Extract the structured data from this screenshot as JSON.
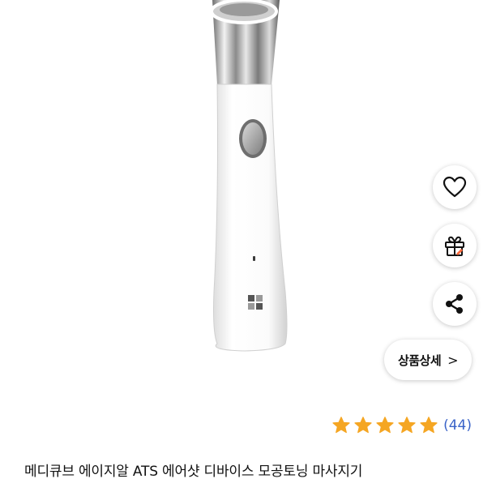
{
  "product": {
    "title": "메디큐브 에이지알 ATS 에어샷 디바이스 모공토닝 마사지기",
    "image_alt": "product-image-skin-device"
  },
  "actions": {
    "wishlist_icon": "heart-icon",
    "gift_icon": "gift-icon",
    "share_icon": "share-icon",
    "detail_label": "상품상세",
    "detail_chevron": ">"
  },
  "rating": {
    "stars": 5,
    "count_label": "(44)",
    "star_color": "#f5a623"
  },
  "colors": {
    "accent_link": "#3a63c8",
    "text": "#111111"
  }
}
